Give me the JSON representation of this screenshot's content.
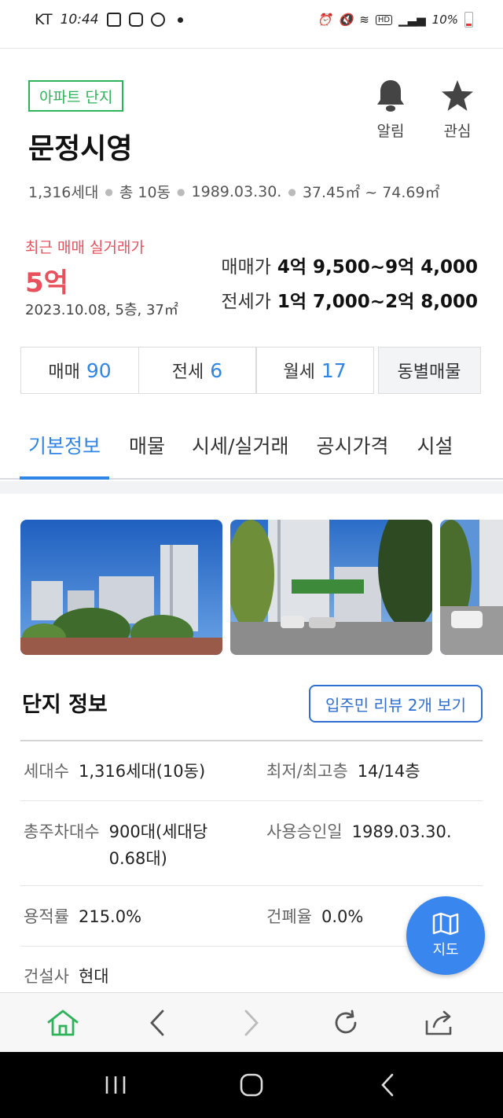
{
  "status_bar": {
    "carrier": "KT",
    "time": "10:44",
    "battery": "10%",
    "hd": "HD"
  },
  "complex": {
    "tag": "아파트 단지",
    "name": "문정시영",
    "households": "1,316세대",
    "buildings": "총 10동",
    "approval_date": "1989.03.30.",
    "area_range": "37.45㎡ ~ 74.69㎡"
  },
  "actions": {
    "alarm_label": "알림",
    "favorite_label": "관심"
  },
  "recent_trade": {
    "label": "최근 매매 실거래가",
    "price": "5억",
    "detail": "2023.10.08, 5층, 37㎡"
  },
  "prices": {
    "sale_label": "매매가",
    "sale_value": "4억 9,500~9억 4,000",
    "jeonse_label": "전세가",
    "jeonse_value": "1억 7,000~2억 8,000"
  },
  "listing_counts": [
    {
      "label": "매매",
      "count": "90"
    },
    {
      "label": "전세",
      "count": "6"
    },
    {
      "label": "월세",
      "count": "17"
    }
  ],
  "dong_listing_label": "동별매물",
  "tabs": [
    {
      "label": "기본정보",
      "active": true
    },
    {
      "label": "매물",
      "active": false
    },
    {
      "label": "시세/실거래",
      "active": false
    },
    {
      "label": "공시가격",
      "active": false
    },
    {
      "label": "시설",
      "active": false
    }
  ],
  "section": {
    "title": "단지 정보",
    "review_button": "입주민 리뷰 2개 보기"
  },
  "info": {
    "households_label": "세대수",
    "households_value": "1,316세대(10동)",
    "floors_label": "최저/최고층",
    "floors_value": "14/14층",
    "parking_label": "총주차대수",
    "parking_value_line1": "900대(세대당",
    "parking_value_line2": "0.68대)",
    "approval_label": "사용승인일",
    "approval_value": "1989.03.30.",
    "far_label": "용적률",
    "far_value": "215.0%",
    "bcr_label": "건폐율",
    "bcr_value": "0.0%",
    "builder_label": "건설사",
    "builder_value": "현대"
  },
  "map_button": {
    "label": "지도",
    "color": "#3a86ef"
  },
  "colors": {
    "accent_blue": "#2f86e6",
    "accent_red": "#e8505b",
    "tag_green": "#2fb35a"
  }
}
